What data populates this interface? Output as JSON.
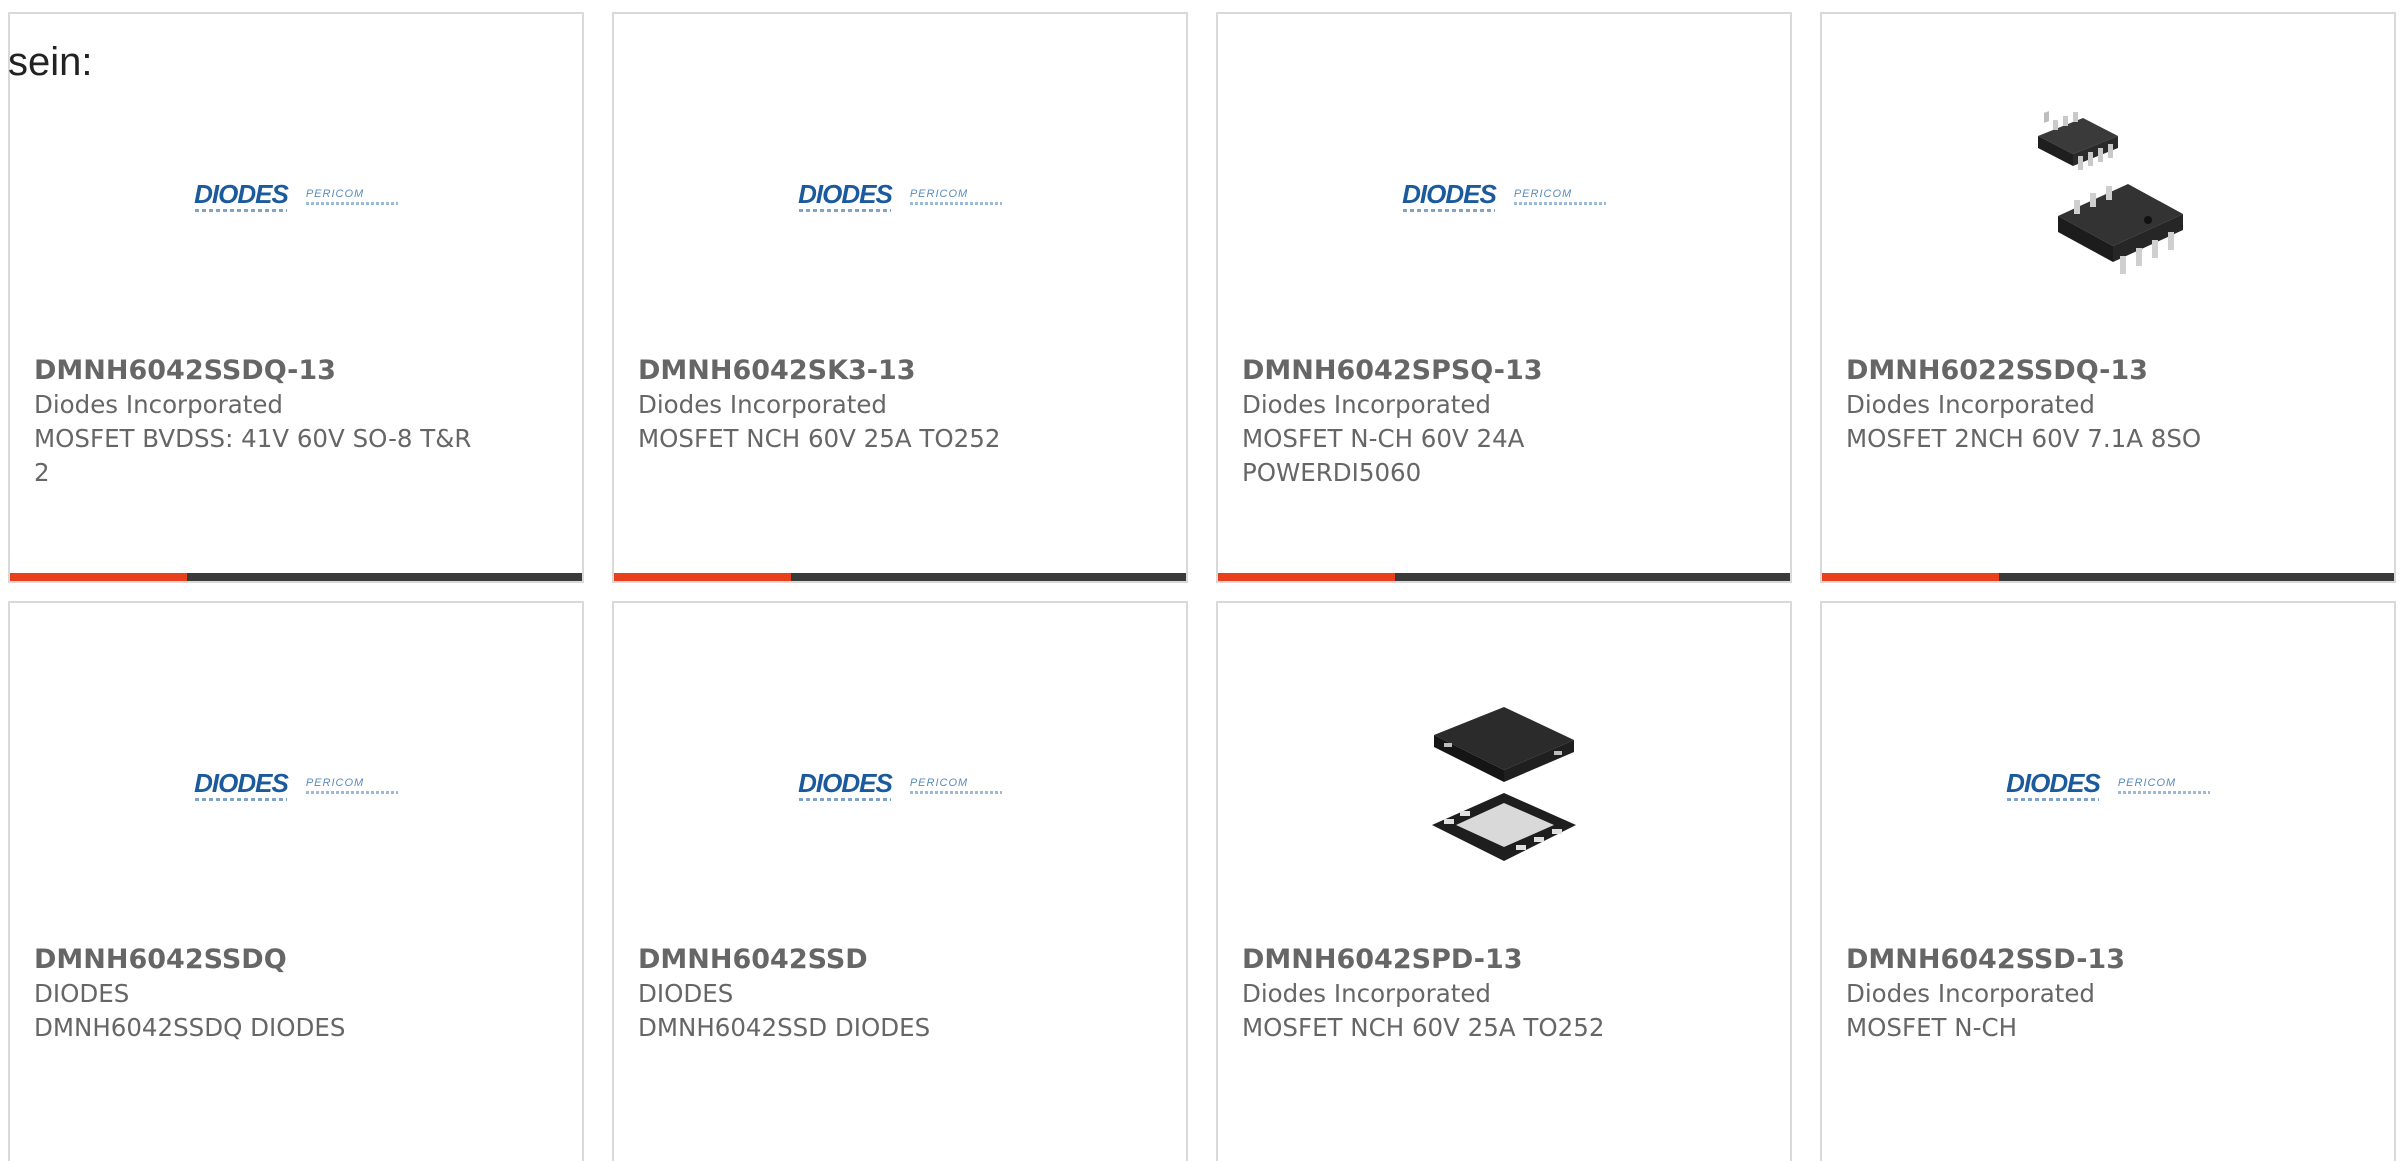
{
  "lead_text": "sein:",
  "brand_logo": {
    "primary": "DIODES",
    "secondary": "PERICOM"
  },
  "colors": {
    "accent": "#e8401c",
    "track": "#3a3a3a",
    "text": "#666666",
    "border": "#d9d9d9",
    "logo_blue": "#1b5a9c"
  },
  "products": [
    {
      "part_number": "DMNH6042SSDQ-13",
      "manufacturer": "Diodes Incorporated",
      "description": "MOSFET BVDSS: 41V 60V SO-8 T&R 2",
      "image": "diodes-pericom-logo",
      "progress": 0.31
    },
    {
      "part_number": "DMNH6042SK3-13",
      "manufacturer": "Diodes Incorporated",
      "description": "MOSFET NCH 60V 25A TO252",
      "image": "diodes-pericom-logo",
      "progress": 0.31
    },
    {
      "part_number": "DMNH6042SPSQ-13",
      "manufacturer": "Diodes Incorporated",
      "description": "MOSFET N-CH 60V 24A POWERDI5060",
      "image": "diodes-pericom-logo",
      "progress": 0.31
    },
    {
      "part_number": "DMNH6022SSDQ-13",
      "manufacturer": "Diodes Incorporated",
      "description": "MOSFET 2NCH 60V 7.1A 8SO",
      "image": "so8-chip-photo",
      "progress": 0.31
    },
    {
      "part_number": "DMNH6042SSDQ",
      "manufacturer": "DIODES",
      "description": "DMNH6042SSDQ DIODES",
      "image": "diodes-pericom-logo"
    },
    {
      "part_number": "DMNH6042SSD",
      "manufacturer": "DIODES",
      "description": "DMNH6042SSD DIODES",
      "image": "diodes-pericom-logo"
    },
    {
      "part_number": "DMNH6042SPD-13",
      "manufacturer": "Diodes Incorporated",
      "description": "MOSFET NCH 60V 25A TO252",
      "image": "powerdi-chip-photo"
    },
    {
      "part_number": "DMNH6042SSD-13",
      "manufacturer": "Diodes Incorporated",
      "description": "MOSFET N-CH",
      "image": "diodes-pericom-logo"
    }
  ]
}
